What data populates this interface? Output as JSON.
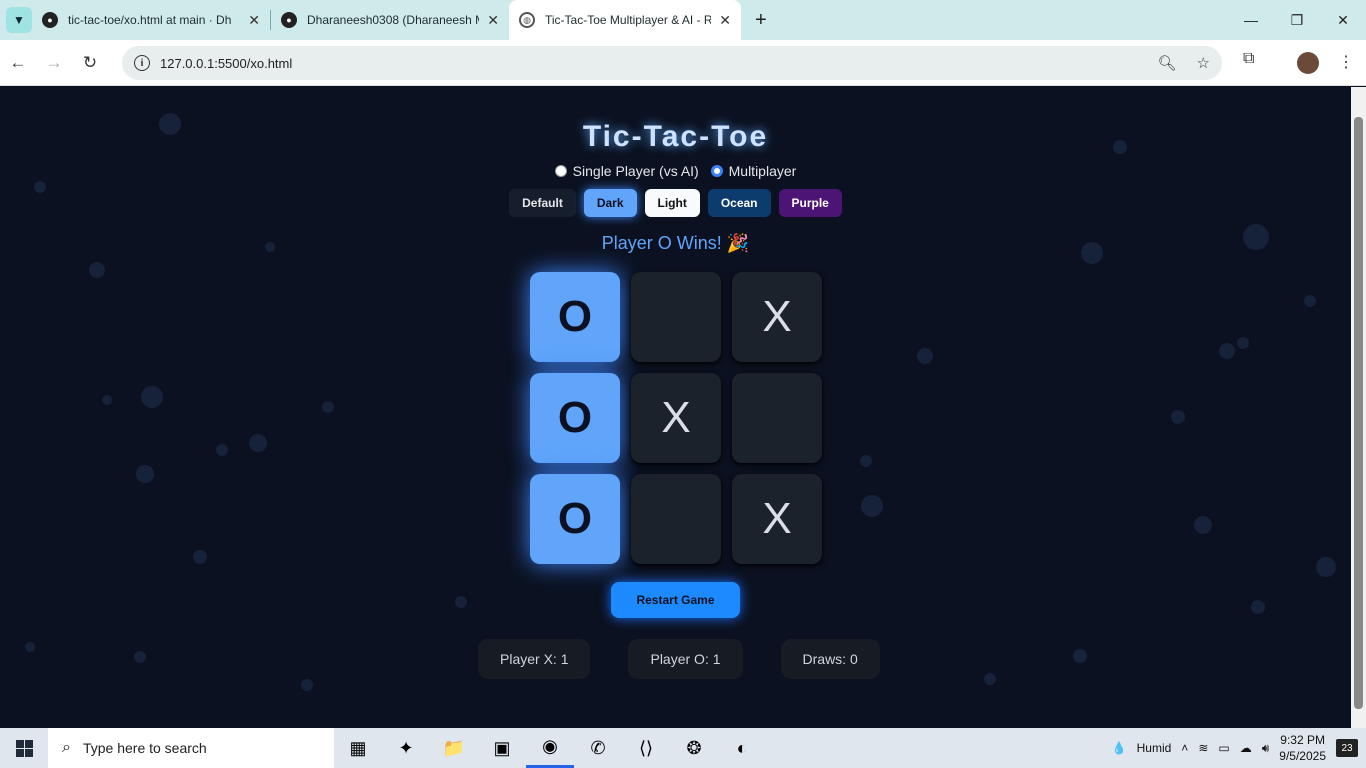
{
  "browser": {
    "tabs": [
      {
        "title": "tic-tac-toe/xo.html at main · Dh",
        "icon": "github-icon"
      },
      {
        "title": "Dharaneesh0308 (Dharaneesh M",
        "icon": "github-icon"
      },
      {
        "title": "Tic-Tac-Toe Multiplayer & AI - R",
        "icon": "globe-icon"
      }
    ],
    "url": "127.0.0.1:5500/xo.html"
  },
  "game": {
    "title": "Tic-Tac-Toe",
    "modes": [
      {
        "label": "Single Player (vs AI)",
        "selected": false
      },
      {
        "label": "Multiplayer",
        "selected": true
      }
    ],
    "themes": [
      "Default",
      "Dark",
      "Light",
      "Ocean",
      "Purple"
    ],
    "active_theme": "Dark",
    "status": "Player O Wins! 🎉",
    "board": [
      "O",
      "",
      "X",
      "O",
      "X",
      "",
      "O",
      "",
      "X"
    ],
    "winning_cells": [
      0,
      3,
      6
    ],
    "restart_label": "Restart Game",
    "scores": {
      "x": "Player X: 1",
      "o": "Player O: 1",
      "draws": "Draws: 0"
    }
  },
  "taskbar": {
    "search_placeholder": "Type here to search",
    "weather": "Humid",
    "time": "9:32 PM",
    "date": "9/5/2025",
    "notifications": "23"
  },
  "colors": {
    "accent": "#60a5fa",
    "background": "#0b1120"
  }
}
